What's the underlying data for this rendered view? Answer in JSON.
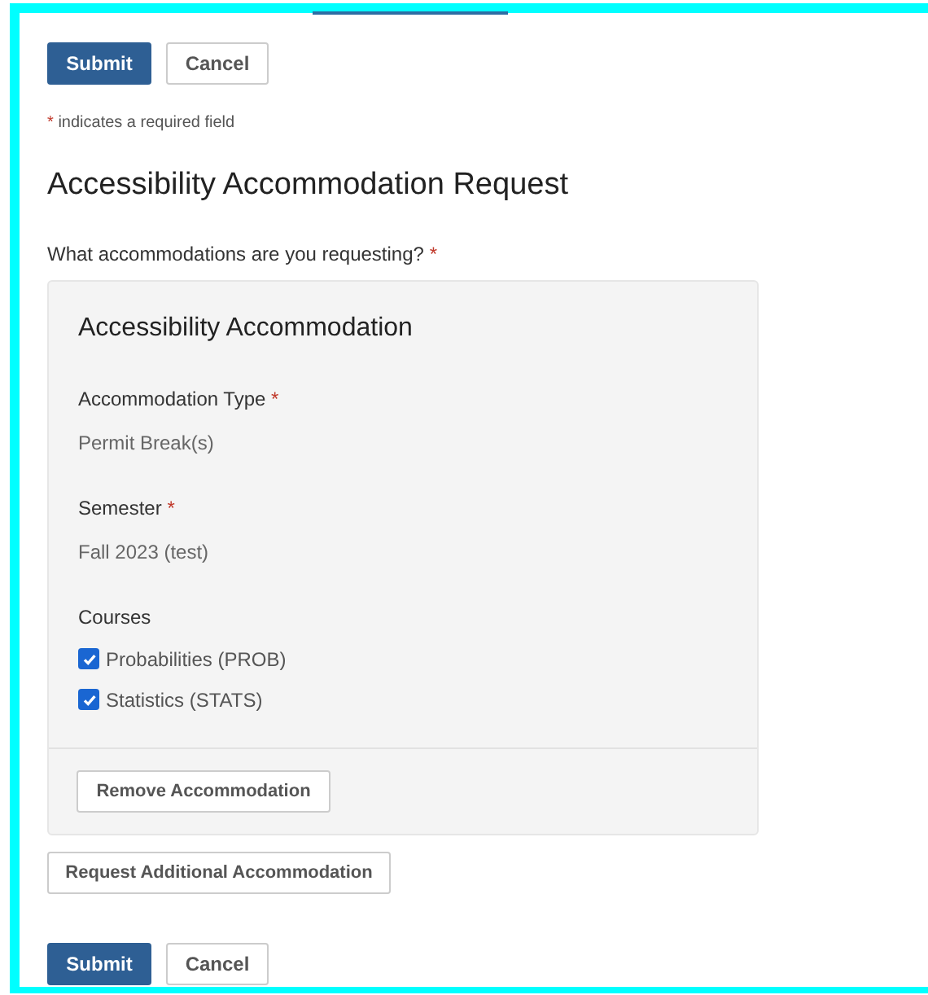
{
  "top_actions": [
    {
      "label": "Submit",
      "kind": "primary"
    },
    {
      "label": "Cancel",
      "kind": "secondary"
    }
  ],
  "required_note": {
    "mark": "*",
    "text": "indicates a required field"
  },
  "title": "Accessibility Accommodation Request",
  "question": {
    "label": "What accommodations are you requesting?",
    "mark": "*"
  },
  "accommodation": {
    "title": "Accessibility Accommodation",
    "fields": [
      {
        "label": "Accommodation Type",
        "mark": "*",
        "value": "Permit Break(s)"
      },
      {
        "label": "Semester",
        "mark": "*",
        "value": "Fall 2023 (test)"
      }
    ],
    "courses": {
      "label": "Courses",
      "items": [
        {
          "label": "Probabilities (PROB)",
          "checked": true
        },
        {
          "label": "Statistics (STATS)",
          "checked": true
        }
      ]
    },
    "remove_button": "Remove Accommodation"
  },
  "add_button": "Request Additional Accommodation",
  "bottom_actions": [
    {
      "label": "Submit",
      "kind": "primary"
    },
    {
      "label": "Cancel",
      "kind": "secondary"
    }
  ]
}
